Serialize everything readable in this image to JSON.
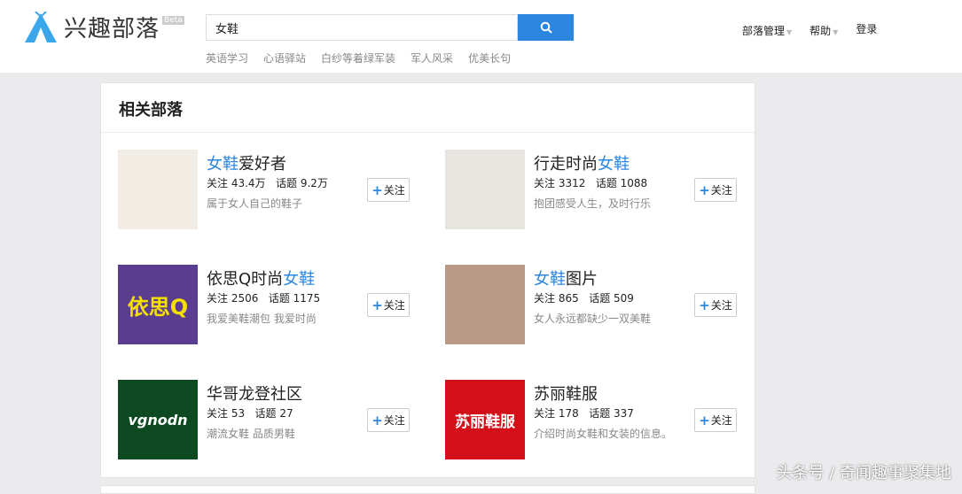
{
  "header": {
    "logo_text": "兴趣部落",
    "beta": "Beta",
    "search_value": "女鞋",
    "hot_searches": [
      "英语学习",
      "心语驿站",
      "白纱等着绿军装",
      "军人风采",
      "优美长句"
    ],
    "nav": {
      "manage": "部落管理",
      "help": "帮助",
      "login": "登录"
    }
  },
  "panel": {
    "title": "相关部落",
    "items": [
      {
        "name_hl": "女鞋",
        "name_rest": "爱好者",
        "name_pre": "",
        "follow": "关注 43.4万",
        "topics": "话题 9.2万",
        "desc": "属于女人自己的鞋子",
        "button": "关注",
        "thumb_color": "#f1ece4",
        "thumb_text": ""
      },
      {
        "name_pre": "行走时尚",
        "name_hl": "女鞋",
        "name_rest": "",
        "follow": "关注 3312",
        "topics": "话题 1088",
        "desc": "抱团感受人生，及时行乐",
        "button": "关注",
        "thumb_color": "#e8e4e0",
        "thumb_text": ""
      },
      {
        "name_pre": "依思Q时尚",
        "name_hl": "女鞋",
        "name_rest": "",
        "follow": "关注 2506",
        "topics": "话题 1175",
        "desc": "我爱美鞋潮包 我爱时尚",
        "button": "关注",
        "thumb_color": "#5b3d8f",
        "thumb_text": "依思Q"
      },
      {
        "name_pre": "",
        "name_hl": "女鞋",
        "name_rest": "图片",
        "follow": "关注 865",
        "topics": "话题 509",
        "desc": "女人永远都缺少一双美鞋",
        "button": "关注",
        "thumb_color": "#b99a86",
        "thumb_text": ""
      },
      {
        "name_pre": "华哥龙登社区",
        "name_hl": "",
        "name_rest": "",
        "follow": "关注 53",
        "topics": "话题 27",
        "desc": "潮流女鞋 品质男鞋",
        "button": "关注",
        "thumb_color": "#0d4a22",
        "thumb_text": "vgnodn"
      },
      {
        "name_pre": "苏丽鞋服",
        "name_hl": "",
        "name_rest": "",
        "follow": "关注 178",
        "topics": "话题 337",
        "desc": "介绍时尚女鞋和女装的信息。",
        "button": "关注",
        "thumb_color": "#d3101a",
        "thumb_text": "苏丽鞋服"
      }
    ]
  },
  "watermark": "头条号 / 奇闻趣事聚集地"
}
